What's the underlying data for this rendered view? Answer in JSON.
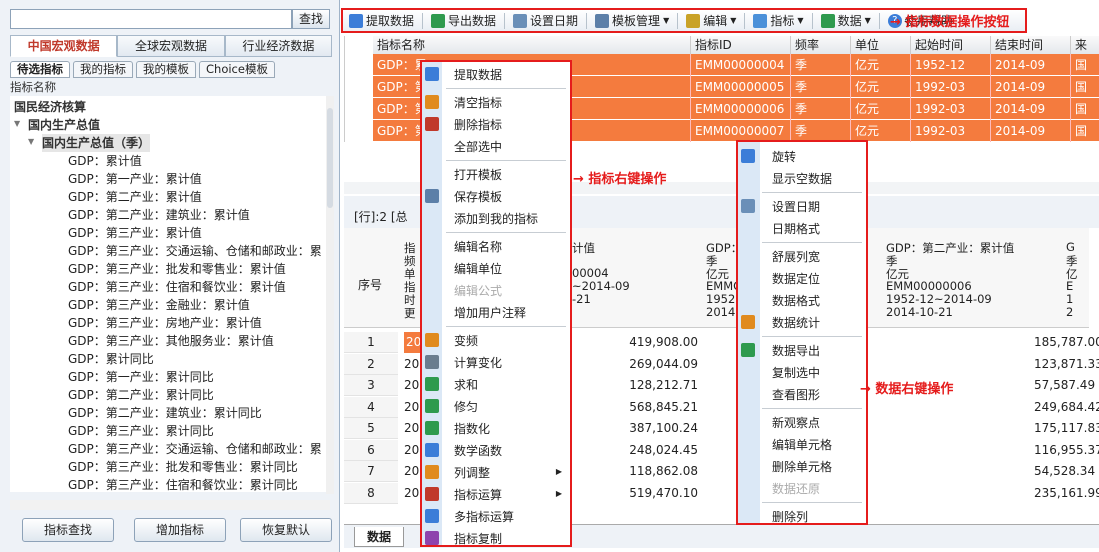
{
  "left": {
    "search_placeholder": "",
    "search_button": "查找",
    "tabs": [
      "中国宏观数据",
      "全球宏观数据",
      "行业经济数据"
    ],
    "subtabs": [
      "待选指标",
      "我的指标",
      "我的模板",
      "Choice模板"
    ],
    "tree_header": "指标名称",
    "tree": [
      {
        "label": "国民经济核算",
        "level": 0,
        "bold": true
      },
      {
        "label": "国内生产总值",
        "level": 1,
        "bold": true
      },
      {
        "label": "国内生产总值（季）",
        "level": 2,
        "bold": true
      },
      {
        "label": "GDP：累计值",
        "level": 3
      },
      {
        "label": "GDP：第一产业：累计值",
        "level": 3
      },
      {
        "label": "GDP：第二产业：累计值",
        "level": 3
      },
      {
        "label": "GDP：第二产业：建筑业：累计值",
        "level": 3
      },
      {
        "label": "GDP：第三产业：累计值",
        "level": 3
      },
      {
        "label": "GDP：第三产业：交通运输、仓储和邮政业：累",
        "level": 3
      },
      {
        "label": "GDP：第三产业：批发和零售业：累计值",
        "level": 3
      },
      {
        "label": "GDP：第三产业：住宿和餐饮业：累计值",
        "level": 3
      },
      {
        "label": "GDP：第三产业：金融业：累计值",
        "level": 3
      },
      {
        "label": "GDP：第三产业：房地产业：累计值",
        "level": 3
      },
      {
        "label": "GDP：第三产业：其他服务业：累计值",
        "level": 3
      },
      {
        "label": "GDP：累计同比",
        "level": 3
      },
      {
        "label": "GDP：第一产业：累计同比",
        "level": 3
      },
      {
        "label": "GDP：第二产业：累计同比",
        "level": 3
      },
      {
        "label": "GDP：第二产业：建筑业：累计同比",
        "level": 3
      },
      {
        "label": "GDP：第三产业：累计同比",
        "level": 3
      },
      {
        "label": "GDP：第三产业：交通运输、仓储和邮政业：累",
        "level": 3
      },
      {
        "label": "GDP：第三产业：批发和零售业：累计同比",
        "level": 3
      },
      {
        "label": "GDP：第三产业：住宿和餐饮业：累计同比",
        "level": 3
      }
    ],
    "buttons": [
      "指标查找",
      "增加指标",
      "恢复默认"
    ]
  },
  "toolbar": {
    "items": [
      {
        "label": "提取数据",
        "color": "#3b7dd8"
      },
      {
        "label": "导出数据",
        "color": "#2e9a4e"
      },
      {
        "label": "设置日期",
        "color": "#6a8fb8"
      },
      {
        "label": "模板管理",
        "color": "#5c7fa8",
        "dd": true
      },
      {
        "label": "编辑",
        "color": "#c9a227",
        "dd": true
      },
      {
        "label": "指标",
        "color": "#4a90d9",
        "dd": true
      },
      {
        "label": "数据",
        "color": "#2e9a4e",
        "dd": true
      }
    ],
    "help": "使用帮助",
    "annotation": "→ 指标数据操作按钮"
  },
  "grid1": {
    "headers": [
      "指标名称",
      "指标ID",
      "频率",
      "单位",
      "起始时间",
      "结束时间",
      "来"
    ],
    "rows": [
      [
        "GDP：累",
        "EMM00000004",
        "季",
        "亿元",
        "1952-12",
        "2014-09",
        "国"
      ],
      [
        "GDP：第",
        "EMM00000005",
        "季",
        "亿元",
        "1992-03",
        "2014-09",
        "国"
      ],
      [
        "GDP：第",
        "EMM00000006",
        "季",
        "亿元",
        "1992-03",
        "2014-09",
        "国"
      ],
      [
        "GDP：第",
        "EMM00000007",
        "季",
        "亿元",
        "1992-03",
        "2014-09",
        "国"
      ]
    ]
  },
  "info": "[行]:2  [总",
  "grid2": {
    "seq_header": "序号",
    "col_header_left": [
      "指",
      "频",
      "单",
      "指",
      "时",
      "更"
    ],
    "col_a": [
      "计值",
      "",
      "00004",
      "~2014-09",
      "-21"
    ],
    "col_b": [
      "GDP：",
      "季",
      "亿元",
      "EMMO",
      "1952",
      "2014"
    ],
    "col_c": [
      "GDP：第二产业：累计值",
      "季",
      "亿元",
      "EMM00000006",
      "1952-12~2014-09",
      "2014-10-21"
    ],
    "col_d": [
      "G",
      "季",
      "亿",
      "E",
      "1",
      "2"
    ],
    "rows": [
      {
        "n": "1",
        "d": "20",
        "a": "419,908.00",
        "b": "00",
        "c": "185,787.00"
      },
      {
        "n": "2",
        "d": "20",
        "a": "269,044.09",
        "b": "00",
        "c": "123,871.33"
      },
      {
        "n": "3",
        "d": "20",
        "a": "128,212.71",
        "b": "58",
        "c": "57,587.49"
      },
      {
        "n": "4",
        "d": "20",
        "a": "568,845.21",
        "b": "00",
        "c": "249,684.42"
      },
      {
        "n": "5",
        "d": "20",
        "a": "387,100.24",
        "b": "00",
        "c": "175,117.83"
      },
      {
        "n": "6",
        "d": "20",
        "a": "248,024.45",
        "b": "00",
        "c": "116,955.37"
      },
      {
        "n": "7",
        "d": "20",
        "a": "118,862.08",
        "b": "00",
        "c": "54,528.34"
      },
      {
        "n": "8",
        "d": "20",
        "a": "519,470.10",
        "b": "53",
        "c": "235,161.99"
      }
    ]
  },
  "bottom_tab": "数据",
  "menu1": {
    "annotation": "→ 指标右键操作",
    "items": [
      {
        "label": "提取数据",
        "icon": "extract-icon",
        "color": "#3b7dd8"
      },
      {
        "sep": true
      },
      {
        "label": "清空指标",
        "icon": "clear-icon",
        "color": "#e08a1e"
      },
      {
        "label": "删除指标",
        "icon": "delete-icon",
        "color": "#c0392b"
      },
      {
        "label": "全部选中"
      },
      {
        "sep": true
      },
      {
        "label": "打开模板"
      },
      {
        "label": "保存模板",
        "icon": "save-icon",
        "color": "#5c7fa8"
      },
      {
        "label": "添加到我的指标"
      },
      {
        "sep": true
      },
      {
        "label": "编辑名称"
      },
      {
        "label": "编辑单位"
      },
      {
        "label": "编辑公式",
        "disabled": true
      },
      {
        "label": "增加用户注释"
      },
      {
        "sep": true
      },
      {
        "label": "变频",
        "icon": "frequency-icon",
        "color": "#e08a1e"
      },
      {
        "label": "计算变化",
        "icon": "calc-icon",
        "color": "#6a7d8f"
      },
      {
        "label": "求和",
        "icon": "sum-icon",
        "color": "#2e9a4e"
      },
      {
        "label": "修匀",
        "icon": "smooth-icon",
        "color": "#2e9a4e"
      },
      {
        "label": "指数化",
        "icon": "index-icon",
        "color": "#2e9a4e"
      },
      {
        "label": "数学函数",
        "icon": "math-icon",
        "color": "#3b7dd8"
      },
      {
        "label": "列调整",
        "icon": "column-icon",
        "color": "#e08a1e",
        "sub": true
      },
      {
        "label": "指标运算",
        "icon": "operation-icon",
        "color": "#c0392b",
        "sub": true
      },
      {
        "label": "多指标运算",
        "icon": "multi-sum-icon",
        "color": "#3b7dd8"
      },
      {
        "label": "指标复制",
        "icon": "copy-icon",
        "color": "#8e44ad"
      }
    ]
  },
  "menu2": {
    "annotation": "→ 数据右键操作",
    "items": [
      {
        "label": "旋转",
        "icon": "rotate-icon",
        "color": "#3b7dd8"
      },
      {
        "label": "显示空数据"
      },
      {
        "sep": true
      },
      {
        "label": "设置日期",
        "icon": "calendar-icon",
        "color": "#6a8fb8"
      },
      {
        "label": "日期格式"
      },
      {
        "sep": true
      },
      {
        "label": "舒展列宽"
      },
      {
        "label": "数据定位"
      },
      {
        "label": "数据格式"
      },
      {
        "label": "数据统计",
        "icon": "stats-icon",
        "color": "#e08a1e"
      },
      {
        "sep": true
      },
      {
        "label": "数据导出",
        "icon": "export-icon",
        "color": "#2e9a4e"
      },
      {
        "label": "复制选中"
      },
      {
        "label": "查看图形"
      },
      {
        "sep": true
      },
      {
        "label": "新观察点"
      },
      {
        "label": "编辑单元格"
      },
      {
        "label": "删除单元格"
      },
      {
        "label": "数据还原",
        "disabled": true
      },
      {
        "sep": true
      },
      {
        "label": "删除列"
      }
    ]
  }
}
